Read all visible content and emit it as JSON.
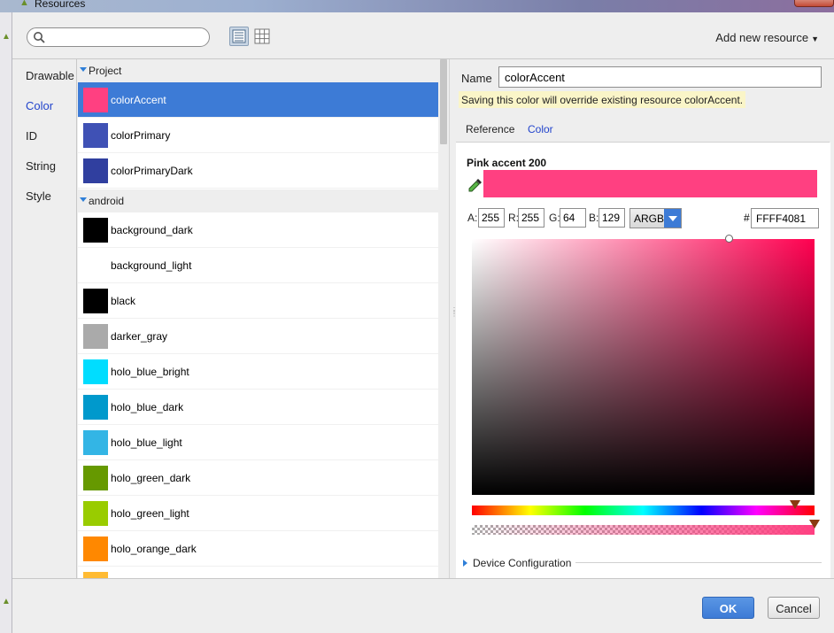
{
  "window": {
    "title": "Resources"
  },
  "toolbar": {
    "search_placeholder": "",
    "add_new_resource": "Add new resource"
  },
  "resource_types": [
    {
      "label": "Drawable",
      "active": false
    },
    {
      "label": "Color",
      "active": true
    },
    {
      "label": "ID",
      "active": false
    },
    {
      "label": "String",
      "active": false
    },
    {
      "label": "Style",
      "active": false
    }
  ],
  "groups": {
    "project": {
      "label": "Project",
      "items": [
        {
          "name": "colorAccent",
          "color": "#ff4081",
          "selected": true
        },
        {
          "name": "colorPrimary",
          "color": "#3f51b5"
        },
        {
          "name": "colorPrimaryDark",
          "color": "#303f9f"
        }
      ]
    },
    "android": {
      "label": "android",
      "items": [
        {
          "name": "background_dark",
          "color": "#000000"
        },
        {
          "name": "background_light",
          "color": "#ffffff"
        },
        {
          "name": "black",
          "color": "#000000"
        },
        {
          "name": "darker_gray",
          "color": "#aaaaaa"
        },
        {
          "name": "holo_blue_bright",
          "color": "#00ddff"
        },
        {
          "name": "holo_blue_dark",
          "color": "#0099cc"
        },
        {
          "name": "holo_blue_light",
          "color": "#33b5e5"
        },
        {
          "name": "holo_green_dark",
          "color": "#669900"
        },
        {
          "name": "holo_green_light",
          "color": "#99cc00"
        },
        {
          "name": "holo_orange_dark",
          "color": "#ff8800"
        },
        {
          "name": "",
          "color": "#ffbb33"
        }
      ]
    }
  },
  "editor": {
    "name_label": "Name",
    "name_value": "colorAccent",
    "warning": "Saving this color will override existing resource colorAccent.",
    "tabs": {
      "reference": "Reference",
      "color": "Color"
    },
    "color_name": "Pink accent 200",
    "color_hex_preview": "#ff4081",
    "channels": [
      {
        "label": "A:",
        "value": "255"
      },
      {
        "label": "R:",
        "value": "255"
      },
      {
        "label": "G:",
        "value": "64"
      },
      {
        "label": "B:",
        "value": "129"
      }
    ],
    "mode": "ARGB",
    "hash": "#",
    "hex_value": "FFFF4081",
    "device_configuration": "Device Configuration"
  },
  "buttons": {
    "ok": "OK",
    "cancel": "Cancel"
  },
  "icons": [
    "android-icon",
    "search-icon",
    "list-view-icon",
    "grid-view-icon",
    "eyedropper-icon",
    "chevron-down-icon"
  ]
}
